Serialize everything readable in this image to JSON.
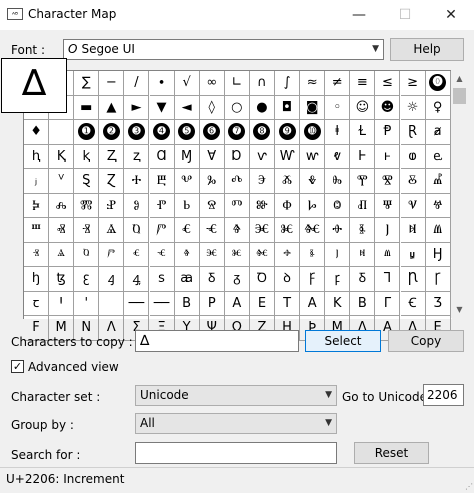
{
  "window": {
    "title": "Character Map"
  },
  "font": {
    "label": "Font :",
    "value": "Segoe UI",
    "help_label": "Help"
  },
  "zoom": {
    "char": "∆"
  },
  "grid": {
    "rows": [
      [
        "",
        "",
        "∑",
        "−",
        "/",
        "∙",
        "√",
        "∞",
        "∟",
        "∩",
        "∫",
        "≈",
        "≠",
        "≡",
        "≤",
        "≥",
        "⓿"
      ],
      [
        "▫",
        "",
        "▬",
        "▲",
        "►",
        "▼",
        "◄",
        "◊",
        "○",
        "●",
        "◘",
        "◙",
        "◦",
        "☺",
        "☻",
        "☼",
        "♀"
      ],
      [
        "♦",
        "",
        "➊",
        "➋",
        "➌",
        "➍",
        "➎",
        "➏",
        "➐",
        "➑",
        "➒",
        "➓",
        "ⱡ",
        "Ɫ",
        "Ᵽ",
        "Ɽ",
        "ⱥ"
      ],
      [
        "ⱨ",
        "Ⱪ",
        "ⱪ",
        "Ⱬ",
        "ⱬ",
        "Ɑ",
        "Ɱ",
        "Ɐ",
        "Ɒ",
        "ⱱ",
        "Ⱳ",
        "ⱳ",
        "ⱴ",
        "Ⱶ",
        "ⱶ",
        "ⱷ",
        "ⱸ"
      ],
      [
        "ⱼ",
        "ⱽ",
        "Ȿ",
        "Ɀ",
        "Ⰰ",
        "Ⰱ",
        "Ⰲ",
        "Ⰳ",
        "Ⰴ",
        "Ⰵ",
        "Ⰶ",
        "Ⰷ",
        "Ⰸ",
        "Ⰹ",
        "Ⰺ",
        "Ⰻ",
        "Ⰼ"
      ],
      [
        "Ⰽ",
        "Ⰾ",
        "Ⰿ",
        "Ⱀ",
        "Ⱁ",
        "Ⱂ",
        "Ⱃ",
        "Ⱄ",
        "Ⱅ",
        "Ⱆ",
        "Ⱇ",
        "Ⱈ",
        "Ⱉ",
        "Ⱊ",
        "Ⱋ",
        "Ⱌ",
        "Ⱍ"
      ],
      [
        "Ⱎ",
        "Ⱏ",
        "Ⱐ",
        "Ⱑ",
        "Ⱒ",
        "Ⱓ",
        "Ⱔ",
        "Ⱕ",
        "Ⱖ",
        "Ⱗ",
        "Ⱘ",
        "Ⱙ",
        "Ⱚ",
        "Ⱛ",
        "Ⱜ",
        "Ⱝ",
        "Ⱞ"
      ],
      [
        "ⱐ",
        "ⱑ",
        "ⱒ",
        "ⱓ",
        "ⱔ",
        "ⱕ",
        "ⱖ",
        "ⱗ",
        "ⱘ",
        "ⱙ",
        "ⱚ",
        "ⱛ",
        "ⱜ",
        "ⱝ",
        "ⱞ",
        "ⱟ",
        "Ꜧ"
      ],
      [
        "ꜧ",
        "ꜩ",
        "ꜫ",
        "ꜭ",
        "ꜯ",
        "ꜱ",
        "ꜳ",
        "Ᵹ",
        "ᵹ",
        "Ꝺ",
        "ꝺ",
        "Ꝼ",
        "ꝼ",
        "Ᵹ",
        "Ꞁ",
        "Ꞃ",
        "Ꞅ"
      ],
      [
        "ꞇ",
        "Ꞌ",
        "ꞌ",
        "",
        "──",
        "──",
        "Β",
        "Ρ",
        "Α",
        "Ε",
        "Τ",
        "Α",
        "Κ",
        "Β",
        "Γ",
        "Ꞓ",
        "Ʒ"
      ],
      [
        "Ϝ",
        "Μ",
        "Ν",
        "Λ",
        "Σ",
        "Ξ",
        "Υ",
        "Ψ",
        "Ω",
        "Ζ",
        "Η",
        "Ϸ",
        "Μ",
        "Λ",
        "Α",
        "Δ",
        "Ε"
      ]
    ]
  },
  "copy": {
    "label": "Characters to copy :",
    "value": "∆",
    "select_label": "Select",
    "copy_label": "Copy"
  },
  "advanced": {
    "checked": true,
    "label": "Advanced view"
  },
  "charset": {
    "label": "Character set :",
    "value": "Unicode"
  },
  "goto": {
    "label": "Go to Unicode :",
    "value": "2206"
  },
  "groupby": {
    "label": "Group by :",
    "value": "All"
  },
  "search": {
    "label": "Search for :",
    "value": "",
    "reset_label": "Reset"
  },
  "status": {
    "text": "U+2206: Increment"
  }
}
